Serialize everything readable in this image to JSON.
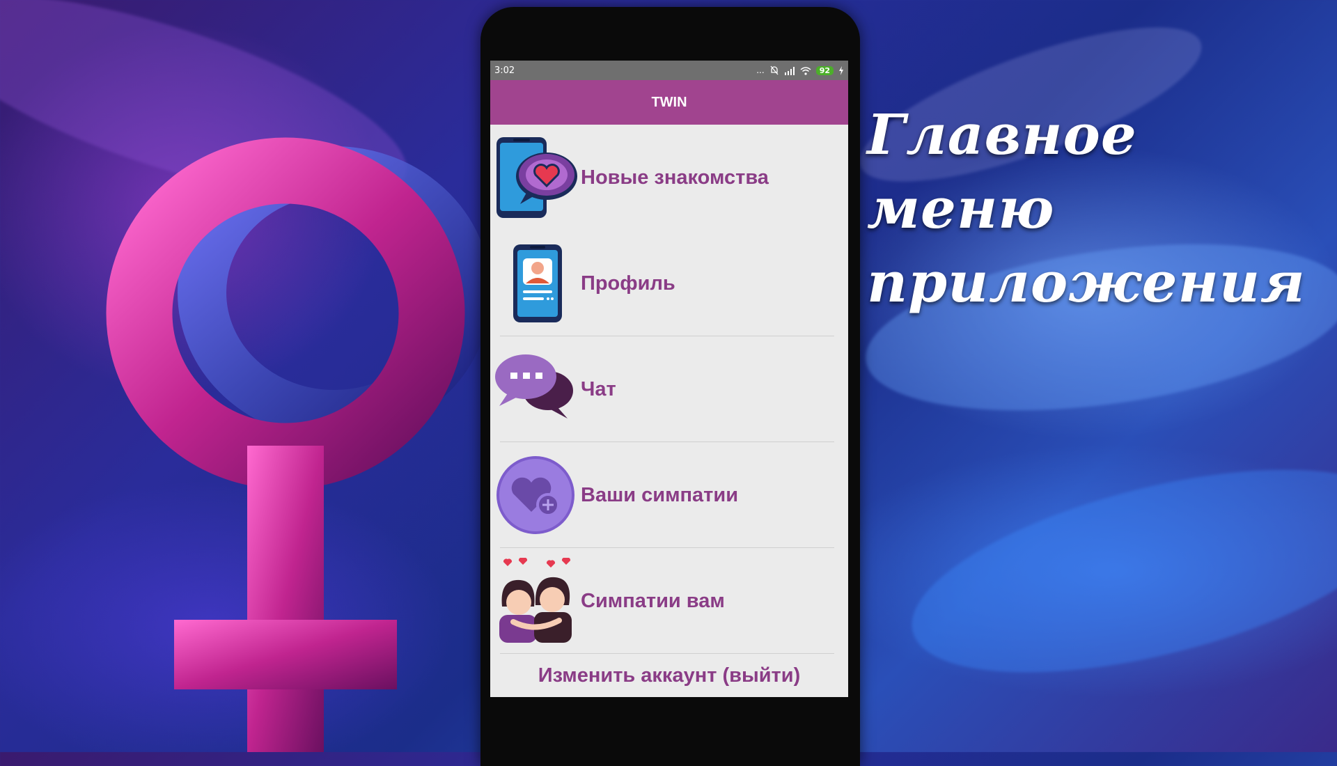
{
  "background": {
    "headline_line1": "Главное меню",
    "headline_line2": "приложения"
  },
  "status_bar": {
    "time": "3:02",
    "dots": "...",
    "battery": "92"
  },
  "app_bar": {
    "title": "TWIN"
  },
  "menu": {
    "items": [
      {
        "label": "Новые знакомства",
        "icon": "phone-heart-chat-icon"
      },
      {
        "label": "Профиль",
        "icon": "phone-profile-icon"
      },
      {
        "label": "Чат",
        "icon": "chat-bubbles-icon"
      },
      {
        "label": "Ваши симпатии",
        "icon": "heart-plus-icon"
      },
      {
        "label": "Симпатии вам",
        "icon": "couple-hearts-icon"
      }
    ],
    "logout_label": "Изменить аккаунт (выйти)"
  },
  "colors": {
    "accent": "#a1448f",
    "label": "#8a3c86",
    "screen_bg": "#ebebeb"
  }
}
